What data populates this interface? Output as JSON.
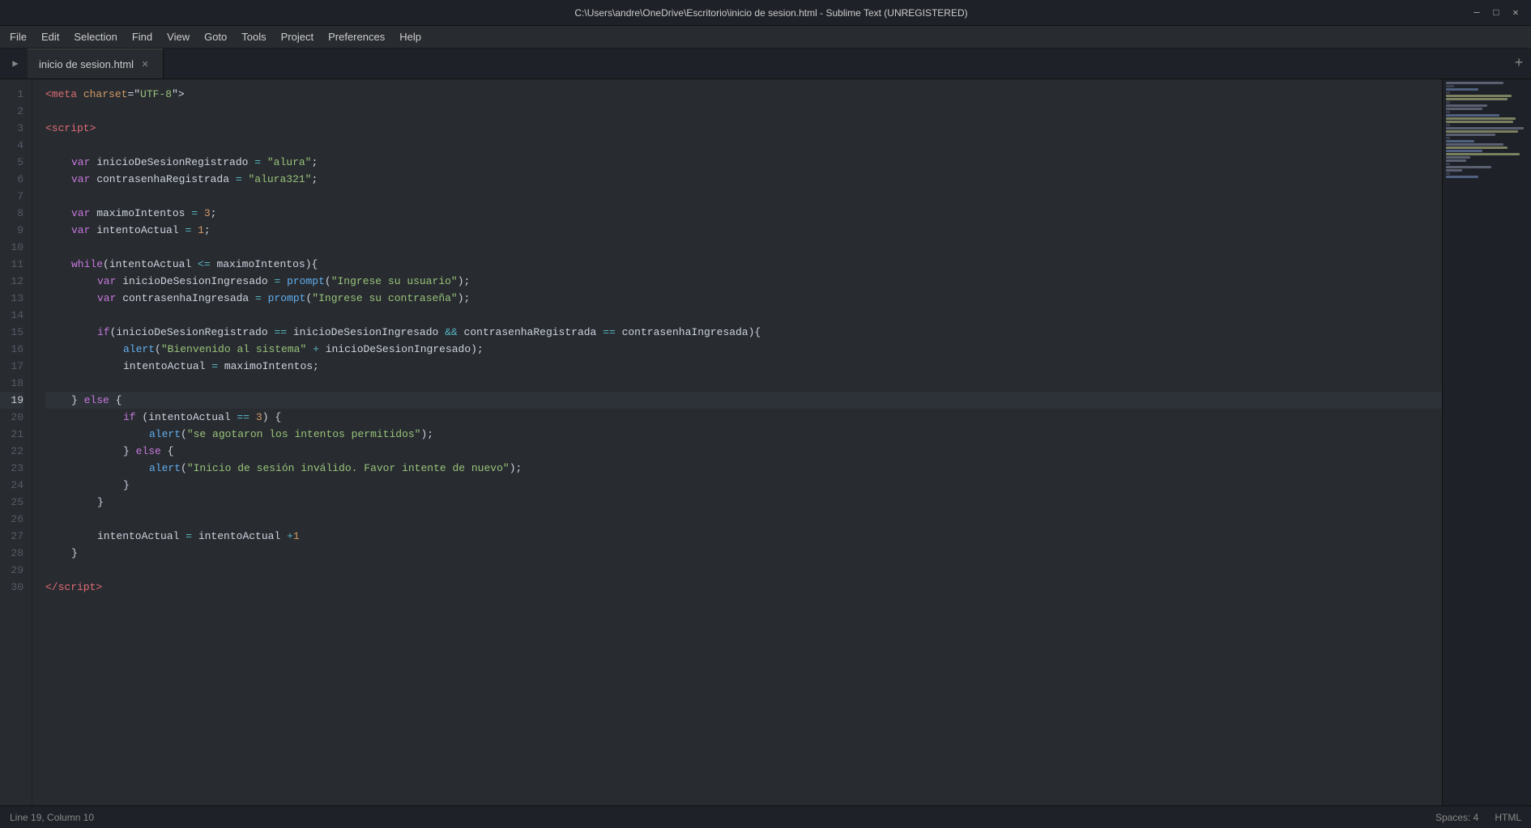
{
  "titleBar": {
    "title": "C:\\Users\\andre\\OneDrive\\Escritorio\\inicio de sesion.html - Sublime Text (UNREGISTERED)"
  },
  "menuBar": {
    "items": [
      "File",
      "Edit",
      "Selection",
      "Find",
      "View",
      "Goto",
      "Tools",
      "Project",
      "Preferences",
      "Help"
    ]
  },
  "tab": {
    "label": "inicio de sesion.html",
    "active": true
  },
  "statusBar": {
    "left": "Line 19, Column 10",
    "right1": "Spaces: 4",
    "right2": "HTML"
  },
  "code": {
    "lines": [
      {
        "num": 1,
        "content": ""
      },
      {
        "num": 2,
        "content": ""
      },
      {
        "num": 3,
        "content": ""
      },
      {
        "num": 4,
        "content": ""
      },
      {
        "num": 5,
        "content": ""
      },
      {
        "num": 6,
        "content": ""
      },
      {
        "num": 7,
        "content": ""
      },
      {
        "num": 8,
        "content": ""
      },
      {
        "num": 9,
        "content": ""
      },
      {
        "num": 10,
        "content": ""
      },
      {
        "num": 11,
        "content": ""
      },
      {
        "num": 12,
        "content": ""
      },
      {
        "num": 13,
        "content": ""
      },
      {
        "num": 14,
        "content": ""
      },
      {
        "num": 15,
        "content": ""
      },
      {
        "num": 16,
        "content": ""
      },
      {
        "num": 17,
        "content": ""
      },
      {
        "num": 18,
        "content": ""
      },
      {
        "num": 19,
        "content": ""
      },
      {
        "num": 20,
        "content": ""
      },
      {
        "num": 21,
        "content": ""
      },
      {
        "num": 22,
        "content": ""
      },
      {
        "num": 23,
        "content": ""
      },
      {
        "num": 24,
        "content": ""
      },
      {
        "num": 25,
        "content": ""
      },
      {
        "num": 26,
        "content": ""
      },
      {
        "num": 27,
        "content": ""
      },
      {
        "num": 28,
        "content": ""
      },
      {
        "num": 29,
        "content": ""
      },
      {
        "num": 30,
        "content": ""
      }
    ]
  },
  "icons": {
    "minimize": "─",
    "maximize": "□",
    "close": "✕",
    "play": "▶",
    "tabClose": "✕",
    "add": "+"
  }
}
